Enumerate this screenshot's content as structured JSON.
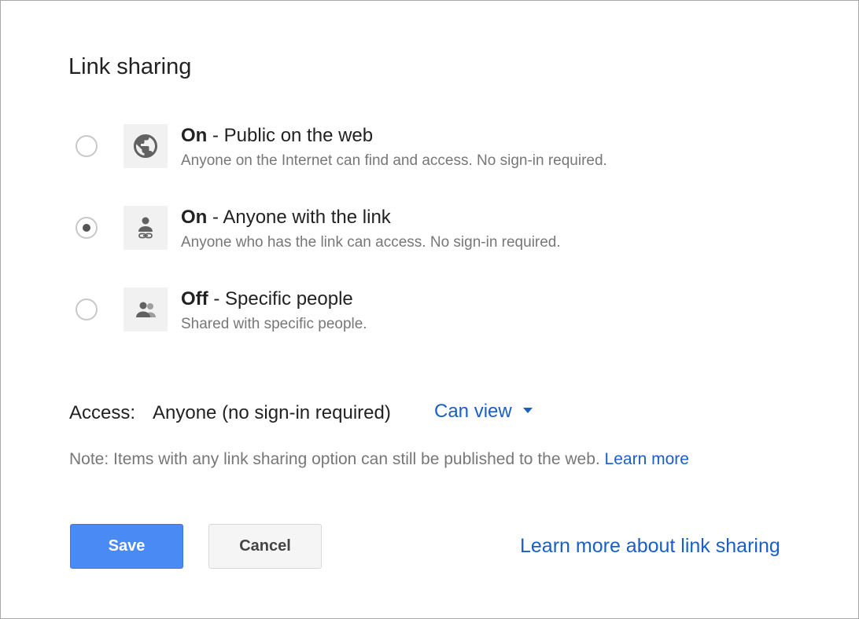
{
  "dialog": {
    "title": "Link sharing"
  },
  "options": [
    {
      "state": "On",
      "label": " - Public on the web",
      "description": "Anyone on the Internet can find and access. No sign-in required.",
      "icon": "globe-icon",
      "selected": false
    },
    {
      "state": "On",
      "label": " - Anyone with the link",
      "description": "Anyone who has the link can access. No sign-in required.",
      "icon": "person-link-icon",
      "selected": true
    },
    {
      "state": "Off",
      "label": " - Specific people",
      "description": "Shared with specific people.",
      "icon": "people-icon",
      "selected": false
    }
  ],
  "access": {
    "label": "Access:",
    "value": "Anyone (no sign-in required)",
    "permission": "Can view"
  },
  "note": {
    "text": "Note: Items with any link sharing option can still be published to the web. ",
    "link": "Learn more"
  },
  "buttons": {
    "save": "Save",
    "cancel": "Cancel"
  },
  "footer": {
    "link": "Learn more about link sharing"
  },
  "colors": {
    "accent": "#4a8af4",
    "link": "#1a5fc6"
  }
}
